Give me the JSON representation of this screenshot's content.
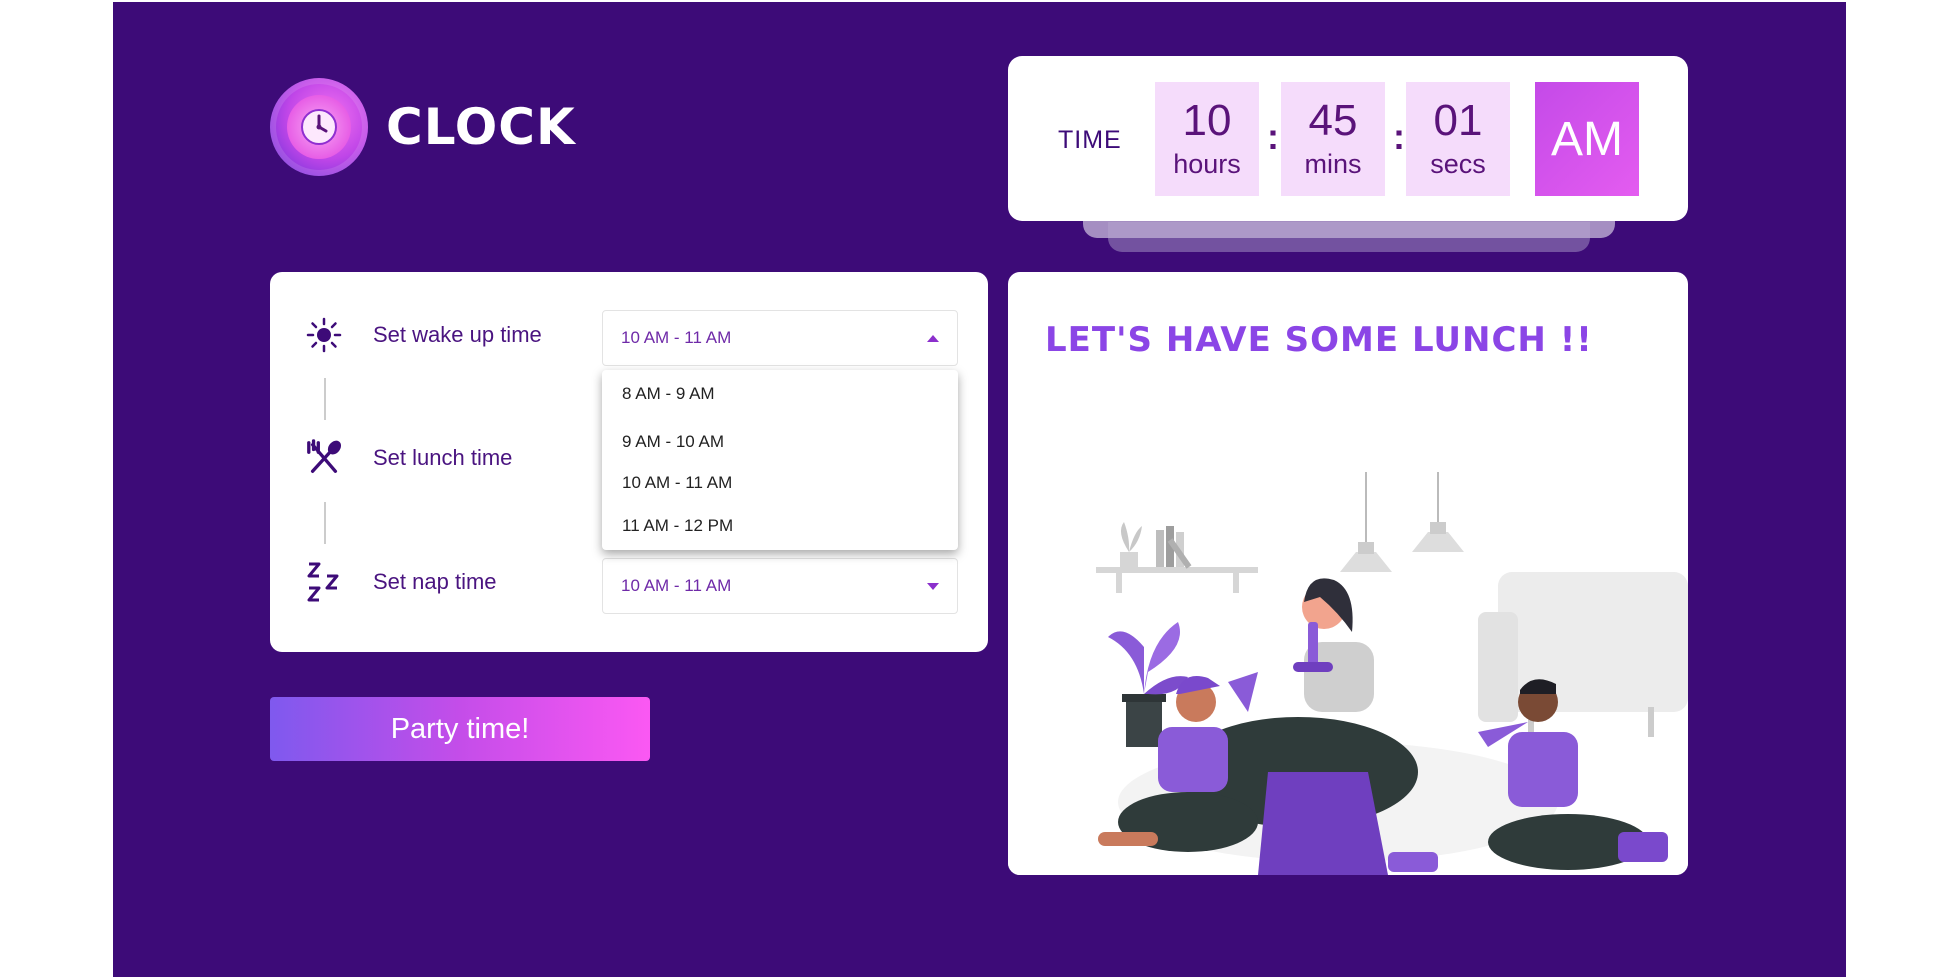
{
  "app": {
    "title": "CLOCK"
  },
  "clock": {
    "label": "TIME",
    "hours": "10",
    "hours_unit": "hours",
    "mins": "45",
    "mins_unit": "mins",
    "secs": "01",
    "secs_unit": "secs",
    "period": "AM"
  },
  "settings": {
    "wake": {
      "label": "Set wake up time",
      "value": "10 AM - 11 AM"
    },
    "lunch": {
      "label": "Set lunch time"
    },
    "nap": {
      "label": "Set nap time",
      "value": "10 AM - 11 AM"
    },
    "dropdown_options": [
      "8 AM - 9 AM",
      "9 AM - 10 AM",
      "10 AM - 11 AM",
      "11 AM - 12 PM"
    ]
  },
  "party_button": {
    "label": "Party time!"
  },
  "message": {
    "title": "LET'S HAVE SOME LUNCH !!"
  },
  "colors": {
    "background": "#3d0b78",
    "accent": "#8b45e6",
    "button_start": "#7f59ee",
    "button_end": "#fb58f3"
  }
}
